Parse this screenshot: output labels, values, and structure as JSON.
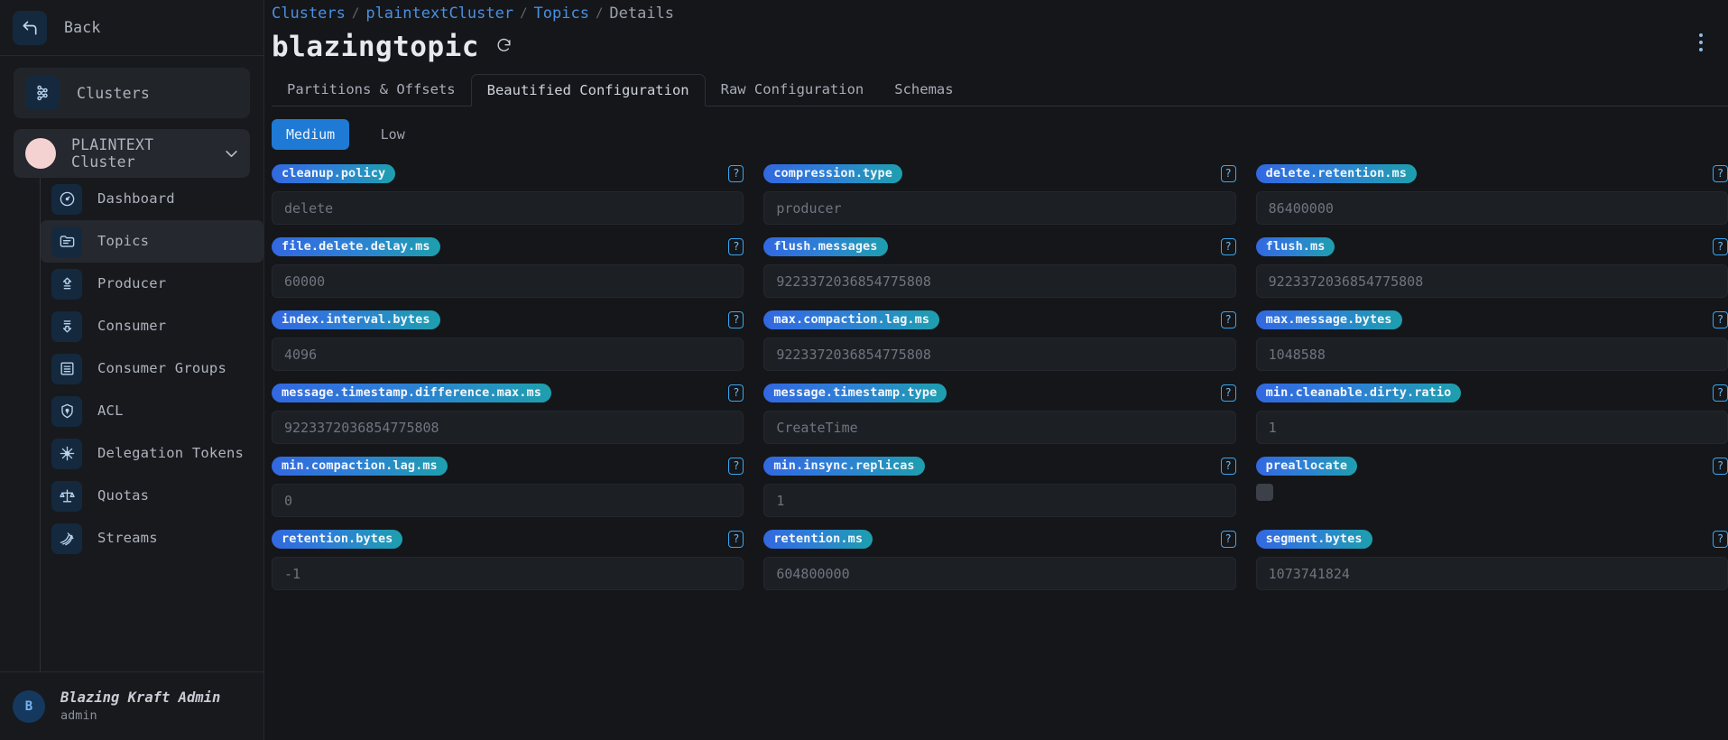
{
  "sidebar": {
    "back_label": "Back",
    "clusters_label": "Clusters",
    "cluster_selector_label": "PLAINTEXT Cluster",
    "items": [
      {
        "label": "Dashboard",
        "icon": "gauge-icon",
        "active": false
      },
      {
        "label": "Topics",
        "icon": "folder-icon",
        "active": true
      },
      {
        "label": "Producer",
        "icon": "upload-icon",
        "active": false
      },
      {
        "label": "Consumer",
        "icon": "download-icon",
        "active": false
      },
      {
        "label": "Consumer Groups",
        "icon": "server-icon",
        "active": false
      },
      {
        "label": "ACL",
        "icon": "shield-icon",
        "active": false
      },
      {
        "label": "Delegation Tokens",
        "icon": "snowflake-icon",
        "active": false
      },
      {
        "label": "Quotas",
        "icon": "scales-icon",
        "active": false
      },
      {
        "label": "Streams",
        "icon": "streams-icon",
        "active": false
      }
    ],
    "user": {
      "initial": "B",
      "name": "Blazing Kraft Admin",
      "role": "admin"
    }
  },
  "breadcrumb": {
    "items": [
      "Clusters",
      "plaintextCluster",
      "Topics",
      "Details"
    ],
    "separator": "/"
  },
  "header": {
    "title": "blazingtopic",
    "refresh_icon": "refresh-icon",
    "menu_icon": "kebab-menu-icon"
  },
  "tabs": [
    {
      "label": "Partitions & Offsets",
      "active": false
    },
    {
      "label": "Beautified Configuration",
      "active": true
    },
    {
      "label": "Raw Configuration",
      "active": false
    },
    {
      "label": "Schemas",
      "active": false
    }
  ],
  "importance_filter": [
    {
      "label": "Medium",
      "active": true
    },
    {
      "label": "Low",
      "active": false
    }
  ],
  "colors": {
    "accent_blue": "#1e7ad4",
    "pill_gradient_start": "#3268e0",
    "pill_gradient_end": "#1e9fae",
    "link": "#4a8fe0",
    "sidebar_bg": "#17191d",
    "main_bg": "#14161a"
  },
  "config_fields": [
    {
      "name": "cleanup.policy",
      "value": "delete",
      "type": "text",
      "help": "?"
    },
    {
      "name": "compression.type",
      "value": "producer",
      "type": "text",
      "help": "?"
    },
    {
      "name": "delete.retention.ms",
      "value": "86400000",
      "type": "text",
      "help": "?"
    },
    {
      "name": "file.delete.delay.ms",
      "value": "60000",
      "type": "text",
      "help": "?"
    },
    {
      "name": "flush.messages",
      "value": "9223372036854775808",
      "type": "text",
      "help": "?"
    },
    {
      "name": "flush.ms",
      "value": "9223372036854775808",
      "type": "text",
      "help": "?"
    },
    {
      "name": "index.interval.bytes",
      "value": "4096",
      "type": "text",
      "help": "?"
    },
    {
      "name": "max.compaction.lag.ms",
      "value": "9223372036854775808",
      "type": "text",
      "help": "?"
    },
    {
      "name": "max.message.bytes",
      "value": "1048588",
      "type": "text",
      "help": "?"
    },
    {
      "name": "message.timestamp.difference.max.ms",
      "value": "9223372036854775808",
      "type": "text",
      "help": "?"
    },
    {
      "name": "message.timestamp.type",
      "value": "CreateTime",
      "type": "text",
      "help": "?"
    },
    {
      "name": "min.cleanable.dirty.ratio",
      "value": "1",
      "type": "text",
      "help": "?"
    },
    {
      "name": "min.compaction.lag.ms",
      "value": "0",
      "type": "text",
      "help": "?"
    },
    {
      "name": "min.insync.replicas",
      "value": "1",
      "type": "text",
      "help": "?"
    },
    {
      "name": "preallocate",
      "value": "",
      "type": "checkbox",
      "checked": false,
      "help": "?"
    },
    {
      "name": "retention.bytes",
      "value": "-1",
      "type": "text",
      "help": "?"
    },
    {
      "name": "retention.ms",
      "value": "604800000",
      "type": "text",
      "help": "?"
    },
    {
      "name": "segment.bytes",
      "value": "1073741824",
      "type": "text",
      "help": "?"
    }
  ]
}
